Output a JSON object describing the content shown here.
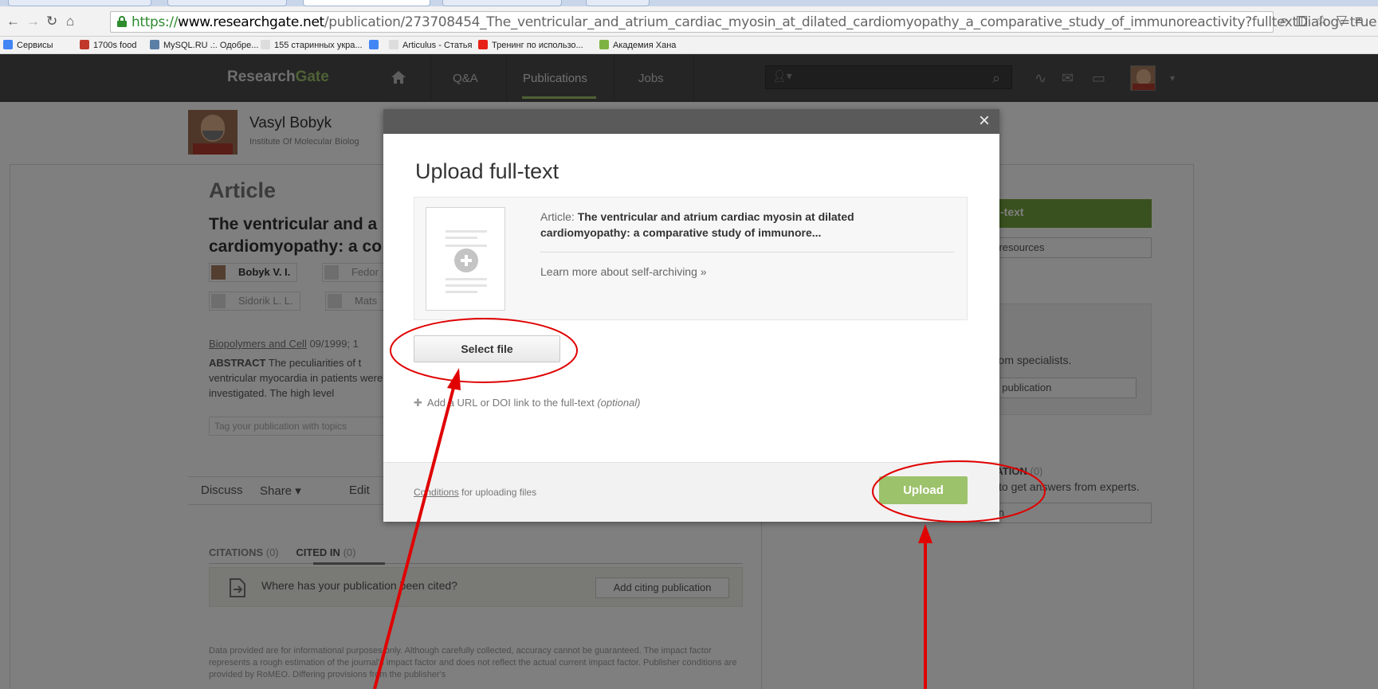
{
  "browser": {
    "url": {
      "scheme": "https://",
      "host": "www.researchgate.net",
      "path": "/publication/273708454_The_ventricular_and_atrium_cardiac_myosin_at_dilated_cardiomyopathy_a_comparative_study_of_immunoreactivity?fulltextDialog=true"
    },
    "bookmarks": [
      {
        "label": "Сервисы",
        "color": "#4285f4"
      },
      {
        "label": "1700s food",
        "color": "#c0392b"
      },
      {
        "label": "MySQL.RU .:. Одобре...",
        "color": "#5b7fa6"
      },
      {
        "label": "155 старинных укра...",
        "color": "#dddddd"
      },
      {
        "label": "",
        "color": "#4285f4"
      },
      {
        "label": "Articulus - Статья",
        "color": "#dddddd"
      },
      {
        "label": "Тренинг по использо...",
        "color": "#e62117"
      },
      {
        "label": "Академия Хана",
        "color": "#7cb342"
      }
    ]
  },
  "site": {
    "logo_a": "Research",
    "logo_b": "Gate",
    "nav": [
      "Q&A",
      "Publications",
      "Jobs"
    ],
    "accent": "#9ec26d"
  },
  "profile": {
    "name": "Vasyl Bobyk",
    "institute": "Institute Of Molecular Biolog"
  },
  "article": {
    "heading": "Article",
    "title_line1": "The ventricular and a",
    "title_line2": "cardiomyopathy: a co",
    "authors": [
      "Bobyk V. I.",
      "Fedor",
      "Sidorik L. L.",
      "Mats"
    ],
    "journal_link": "Biopolymers and Cell",
    "journal_date": " 09/1999; 1",
    "abstract_label": "ABSTRACT",
    "abstract_text": " The peculiarities of t ventricular myocardia in patients were investigated. The high level",
    "tag_placeholder": "Tag your publication with topics",
    "actions": [
      "Discuss",
      "Share ▾",
      "Edit"
    ]
  },
  "citations": {
    "tab1": "CITATIONS",
    "tab1_count": "(0)",
    "tab2": "CITED IN",
    "tab2_count": "(0)",
    "question": "Where has your publication been cited?",
    "add_button": "Add citing publication",
    "disclaimer": "Data provided are for informational purposes only. Although carefully collected, accuracy cannot be guaranteed. The impact factor represents a rough estimation of the journal's impact factor and does not reflect the actual current impact factor. Publisher conditions are provided by RoMEO. Differing provisions from the publisher's"
  },
  "right_column": {
    "green_button": "-text",
    "resources_button": "ry resources",
    "box_count": ")",
    "specialists_text": "from specialists.",
    "publication_button": "his publication",
    "section_head": "CATION",
    "section_count": "(0)",
    "experts_text": "to get answers from experts.",
    "bottom_button": "tion"
  },
  "modal": {
    "title": "Upload full-text",
    "article_label": "Article:",
    "article_title": "The ventricular and atrium cardiac myosin at dilated cardiomyopathy: a comparative study of immunore...",
    "learn_more": "Learn more about self-archiving »",
    "select_file": "Select file",
    "add_url": "Add a URL or DOI link to the full-text",
    "add_url_optional": "(optional)",
    "conditions_link": "Conditions",
    "conditions_rest": " for uploading files",
    "upload": "Upload",
    "close": "×"
  }
}
